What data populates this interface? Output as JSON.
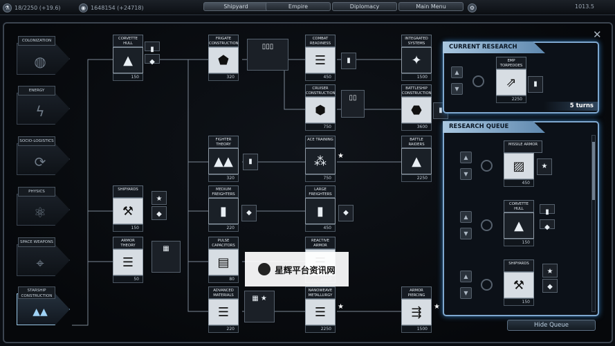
{
  "topbar": {
    "resource1": "18/2250 (+19.6)",
    "resource2": "1648154 (+24718)",
    "tabs": [
      "Shipyard",
      "Empire",
      "Diplomacy",
      "Main Menu"
    ],
    "right_value": "1013.5"
  },
  "categories": [
    {
      "label": "COLONIZATION",
      "icon": "planet-icon"
    },
    {
      "label": "ENERGY",
      "icon": "lightning-icon"
    },
    {
      "label": "SOCIO-LOGISTICS",
      "icon": "cycle-icon"
    },
    {
      "label": "PHYSICS",
      "icon": "atom-icon"
    },
    {
      "label": "SPACE WEAPONS",
      "icon": "turret-icon"
    },
    {
      "label": "STARSHIP CONSTRUCTION",
      "icon": "fleet-icon"
    }
  ],
  "techs": [
    {
      "title": "CORVETTE\nHULL",
      "cost": "150"
    },
    {
      "title": "FRIGATE\nCONSTRUCTION",
      "cost": "320"
    },
    {
      "title": "COMBAT\nREADINESS",
      "cost": "450"
    },
    {
      "title": "INTEGRATED\nSYSTEMS",
      "cost": "1500"
    },
    {
      "title": "CRUISER\nCONSTRUCTION",
      "cost": "750"
    },
    {
      "title": "BATTLESHIP\nCONSTRUCTION",
      "cost": "3600"
    },
    {
      "title": "FIGHTER\nTHEORY",
      "cost": "320"
    },
    {
      "title": "ACE TRAINING",
      "cost": "750"
    },
    {
      "title": "BATTLE\nRAIDERS",
      "cost": "2250"
    },
    {
      "title": "SHIPYARDS",
      "cost": "150"
    },
    {
      "title": "MEDIUM\nFREIGHTERS",
      "cost": "220"
    },
    {
      "title": "LARGE\nFREIGHTERS",
      "cost": "450"
    },
    {
      "title": "ARMOR THEORY",
      "cost": "50"
    },
    {
      "title": "PULSE\nCAPACITORS",
      "cost": "80"
    },
    {
      "title": "REACTIVE\nARMOR",
      "cost": "1500"
    },
    {
      "title": "ADVANCED\nMATERIALS",
      "cost": "220"
    },
    {
      "title": "NANOWEAVE\nMETALLURGY",
      "cost": "2250"
    },
    {
      "title": "ARMOR\nPIERCING",
      "cost": "1500"
    }
  ],
  "current_research": {
    "header": "CURRENT RESEARCH",
    "title": "EMP\nTORPEDOES",
    "cost": "2250",
    "turns": "5 turns"
  },
  "queue": {
    "header": "RESEARCH QUEUE",
    "items": [
      {
        "title": "MISSILE ARMOR",
        "cost": "450"
      },
      {
        "title": "CORVETTE\nHULL",
        "cost": "150"
      },
      {
        "title": "SHIPYARDS",
        "cost": "150"
      }
    ],
    "hide_label": "Hide Queue"
  },
  "watermark": "星辉平台资讯网"
}
